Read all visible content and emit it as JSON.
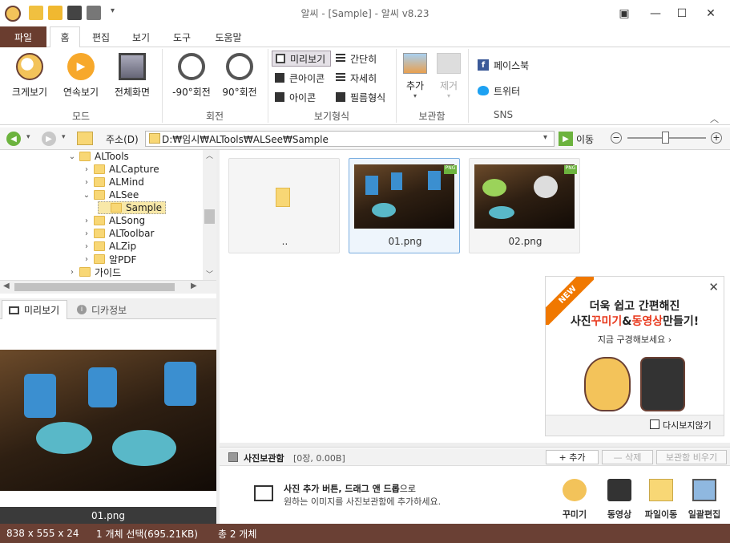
{
  "window": {
    "title": "알씨 - [Sample] - 알씨 v8.23"
  },
  "menu": {
    "file": "파일",
    "tabs": [
      "홈",
      "편집",
      "보기",
      "도구",
      "도움말"
    ]
  },
  "ribbon": {
    "mode": {
      "label": "모드",
      "buttons": [
        "크게보기",
        "연속보기",
        "전체화면"
      ]
    },
    "rotate": {
      "label": "회전",
      "buttons": [
        "-90°회전",
        "90°회전"
      ]
    },
    "view": {
      "label": "보기형식",
      "options": [
        "미리보기",
        "간단히",
        "큰아이콘",
        "자세히",
        "아이콘",
        "필름형식"
      ]
    },
    "album": {
      "label": "보관함",
      "add": "추가",
      "remove": "제거"
    },
    "sns": {
      "label": "SNS",
      "facebook": "페이스북",
      "twitter": "트위터"
    }
  },
  "address": {
    "label": "주소(D)",
    "path": "D:₩임시₩ALTools₩ALSee₩Sample",
    "go": "이동"
  },
  "tree": {
    "items": [
      {
        "label": "ALTools",
        "depth": 0,
        "exp": "open"
      },
      {
        "label": "ALCapture",
        "depth": 1,
        "exp": "closed"
      },
      {
        "label": "ALMind",
        "depth": 1,
        "exp": "closed"
      },
      {
        "label": "ALSee",
        "depth": 1,
        "exp": "open"
      },
      {
        "label": "Sample",
        "depth": 2,
        "exp": "none",
        "selected": true
      },
      {
        "label": "ALSong",
        "depth": 1,
        "exp": "closed"
      },
      {
        "label": "ALToolbar",
        "depth": 1,
        "exp": "closed"
      },
      {
        "label": "ALZip",
        "depth": 1,
        "exp": "closed"
      },
      {
        "label": "알PDF",
        "depth": 1,
        "exp": "closed"
      },
      {
        "label": "가이드",
        "depth": 0,
        "exp": "closed"
      }
    ]
  },
  "panel": {
    "tabs": [
      "미리보기",
      "디카정보"
    ],
    "filename": "01.png"
  },
  "thumbs": [
    {
      "label": "..",
      "type": "folder"
    },
    {
      "label": "01.png",
      "type": "image",
      "badge": "PNG",
      "selected": true
    },
    {
      "label": "02.png",
      "type": "image",
      "badge": "PNG"
    }
  ],
  "ad": {
    "ribbon": "NEW",
    "line1": "더욱 쉽고 간편해진",
    "line2_pre": "사진",
    "line2_a": "꾸미기",
    "line2_amp": "&",
    "line2_b": "동영상",
    "line2_post": "만들기!",
    "link": "지금 구경해보세요 ›",
    "dont_show": "다시보지않기"
  },
  "album": {
    "title": "사진보관함",
    "count": "[0장, 0.00B]",
    "add": "+ 추가",
    "delete": "— 삭제",
    "clear": "보관함 비우기",
    "hint_bold": "사진 추가 버튼, 드래그 앤 드롭",
    "hint_suffix": "으로",
    "hint_line2": "원하는 이미지를 사진보관함에 추가하세요.",
    "tools": [
      "꾸미기",
      "동영상",
      "파일이동",
      "일괄편집"
    ]
  },
  "status": {
    "dims": "838 x 555 x 24",
    "selection": "1 개체 선택(695.21KB)",
    "total": "총 2 개체"
  },
  "colors": {
    "brown": "#6a4034",
    "accent_red": "#e8391d",
    "accent_orange": "#f07800",
    "folder": "#f8d775"
  }
}
